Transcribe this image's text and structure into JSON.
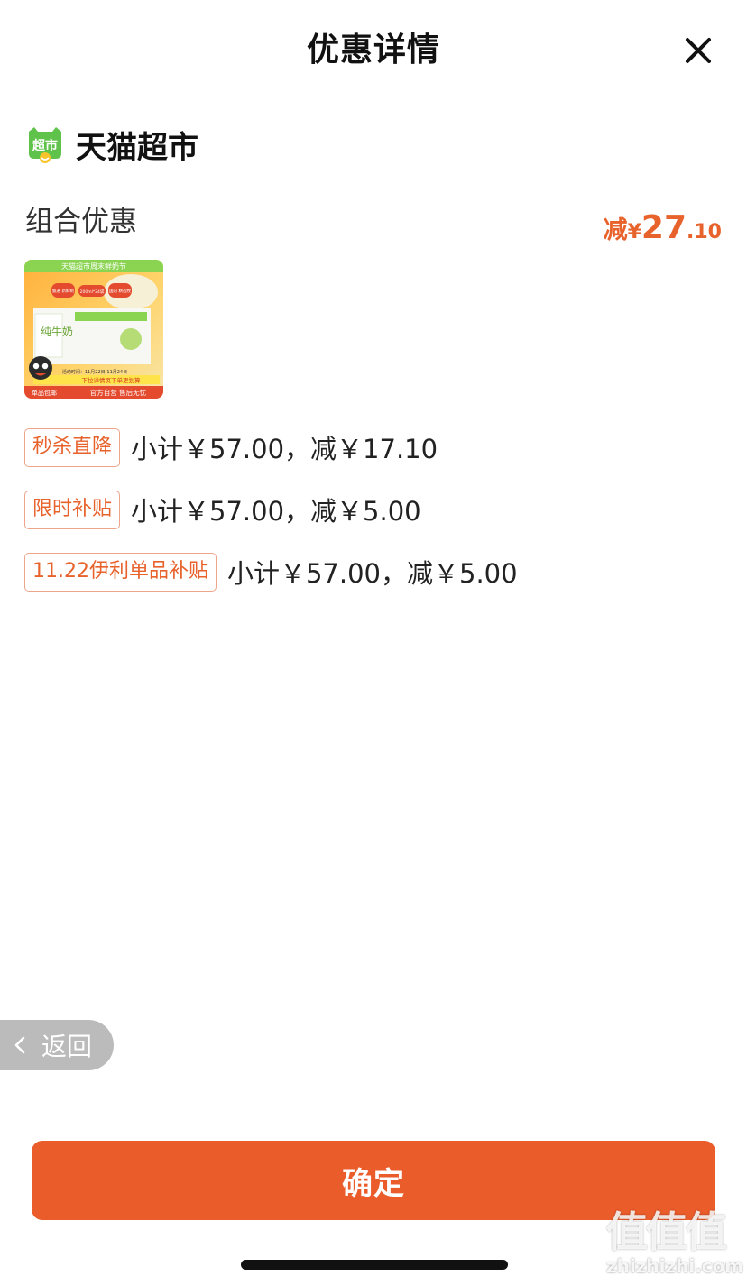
{
  "header": {
    "title": "优惠详情"
  },
  "store": {
    "name": "天猫超市",
    "logo_text": "超市"
  },
  "promo": {
    "title": "组合优惠",
    "total": {
      "prefix": "减",
      "currency": "¥",
      "int": "27",
      "dec": ".10"
    }
  },
  "product_image": {
    "banner_text": "天猫超市周末鲜奶节",
    "badge1": "甄選 新鲜制",
    "badge2": "200ml*24袋",
    "badge3": "国内 精选牧",
    "product_name": "纯牛奶",
    "date_text": "活动时间：11月22日-11月24日",
    "cta_text": "下拉详情页下单更划算",
    "bottom_left": "单品包邮",
    "bottom_right": "官方自营 售后无忧"
  },
  "promo_rows": [
    {
      "tag": "秒杀直降",
      "text": "小计￥57.00，减￥17.10"
    },
    {
      "tag": "限时补贴",
      "text": "小计￥57.00，减￥5.00"
    },
    {
      "tag": "11.22伊利单品补贴",
      "text": "小计￥57.00，减￥5.00"
    }
  ],
  "back": {
    "label": "返回"
  },
  "confirm": {
    "label": "确定"
  },
  "watermark": {
    "glyphs": "值值值",
    "url": "zhizhizhi.com"
  },
  "colors": {
    "accent": "#EB5C2B",
    "tag_border": "#EDA58A",
    "back_bg": "#BBBBBB",
    "store_green": "#5FC24A"
  },
  "icons": {
    "close": "close-icon",
    "back": "chevron-left-icon",
    "store": "tmall-supermarket-logo"
  }
}
